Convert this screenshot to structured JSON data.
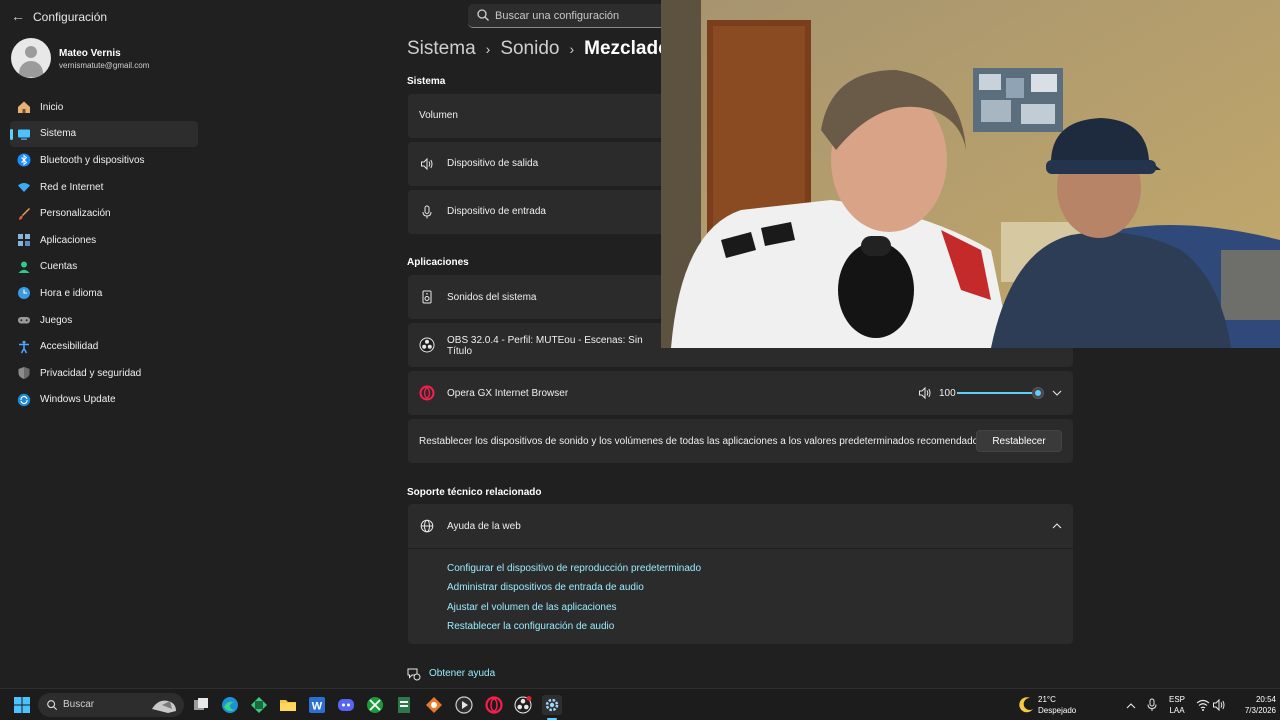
{
  "app": {
    "back": "←",
    "title": "Configuración"
  },
  "search": {
    "placeholder": "Buscar una configuración"
  },
  "profile": {
    "name": "Mateo Vernis",
    "email": "vernismatute@gmail.com"
  },
  "sidebar": {
    "items": [
      {
        "label": "Inicio",
        "icon": "home-icon"
      },
      {
        "label": "Sistema",
        "icon": "system-icon",
        "active": true
      },
      {
        "label": "Bluetooth y dispositivos",
        "icon": "bluetooth-icon"
      },
      {
        "label": "Red e Internet",
        "icon": "wifi-icon"
      },
      {
        "label": "Personalización",
        "icon": "brush-icon"
      },
      {
        "label": "Aplicaciones",
        "icon": "apps-icon"
      },
      {
        "label": "Cuentas",
        "icon": "account-icon"
      },
      {
        "label": "Hora e idioma",
        "icon": "globe-clock-icon"
      },
      {
        "label": "Juegos",
        "icon": "gamepad-icon"
      },
      {
        "label": "Accesibilidad",
        "icon": "accessibility-icon"
      },
      {
        "label": "Privacidad y seguridad",
        "icon": "shield-icon"
      },
      {
        "label": "Windows Update",
        "icon": "update-icon"
      }
    ]
  },
  "breadcrumb": {
    "part1": "Sistema",
    "part2": "Sonido",
    "part3": "Mezclador de volumen"
  },
  "system_section": {
    "title": "Sistema",
    "volume_label": "Volumen",
    "output_label": "Dispositivo de salida",
    "input_label": "Dispositivo de entrada"
  },
  "apps_section": {
    "title": "Aplicaciones",
    "system_sounds": "Sonidos del sistema",
    "obs_line1": "OBS 32.0.4 - Perfil: MUTEou - Escenas: Sin",
    "obs_line2": "Título",
    "opera": "Opera GX Internet Browser",
    "opera_volume": "100",
    "opera_level": 1.0
  },
  "reset": {
    "text": "Restablecer los dispositivos de sonido y los volúmenes de todas las aplicaciones a los valores predeterminados recomendados",
    "button": "Restablecer"
  },
  "support": {
    "title": "Soporte técnico relacionado",
    "help_web": "Ayuda de la web",
    "links": [
      "Configurar el dispositivo de reproducción predeterminado",
      "Administrar dispositivos de entrada de audio",
      "Ajustar el volumen de las aplicaciones",
      "Restablecer la configuración de audio"
    ],
    "get_help": "Obtener ayuda"
  },
  "taskbar": {
    "search_label": "Buscar",
    "weather_temp": "21°C",
    "weather_desc": "Despejado",
    "lang_top": "ESP",
    "lang_bottom": "LAA",
    "time": "20:54",
    "date": "7/3/2026"
  },
  "colors": {
    "accent": "#60cdff",
    "link": "#99ebff",
    "background": "#202020",
    "card": "#2b2b2b"
  }
}
